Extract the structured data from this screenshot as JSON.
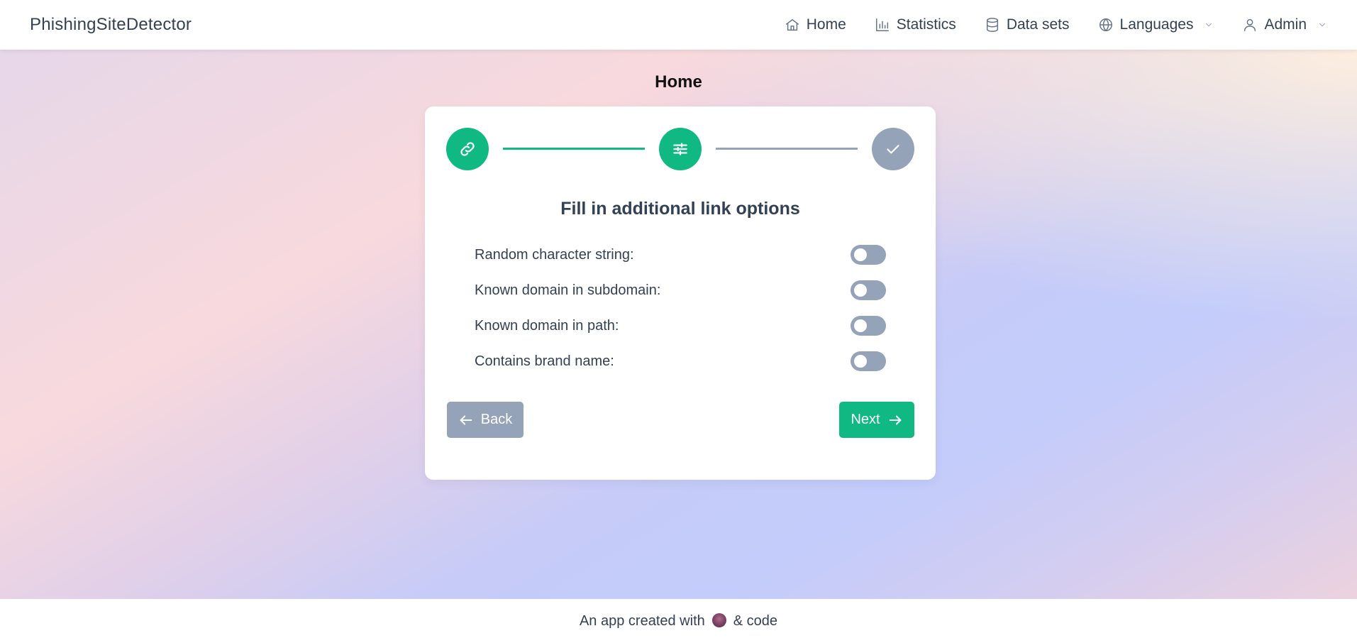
{
  "app": {
    "brand": "PhishingSiteDetector"
  },
  "nav": {
    "items": [
      {
        "label": "Home",
        "icon": "home-icon"
      },
      {
        "label": "Statistics",
        "icon": "bar-chart-icon"
      },
      {
        "label": "Data sets",
        "icon": "database-icon"
      },
      {
        "label": "Languages",
        "icon": "globe-icon",
        "dropdown": true
      },
      {
        "label": "Admin",
        "icon": "user-icon",
        "dropdown": true
      }
    ]
  },
  "page": {
    "title": "Home"
  },
  "stepper": {
    "steps": [
      {
        "icon": "link-icon",
        "state": "complete"
      },
      {
        "icon": "sliders-icon",
        "state": "active"
      },
      {
        "icon": "check-icon",
        "state": "pending"
      }
    ]
  },
  "form": {
    "heading": "Fill in additional link options",
    "options": [
      {
        "label": "Random character string:",
        "enabled": false
      },
      {
        "label": "Known domain in subdomain:",
        "enabled": false
      },
      {
        "label": "Known domain in path:",
        "enabled": false
      },
      {
        "label": "Contains brand name:",
        "enabled": false
      }
    ],
    "back_label": "Back",
    "next_label": "Next"
  },
  "footer": {
    "prefix": "An app created with",
    "suffix": "& code",
    "icon": "coffee-icon"
  },
  "colors": {
    "accent": "#10b981",
    "inactive": "#94a3b8",
    "text": "#334155"
  }
}
